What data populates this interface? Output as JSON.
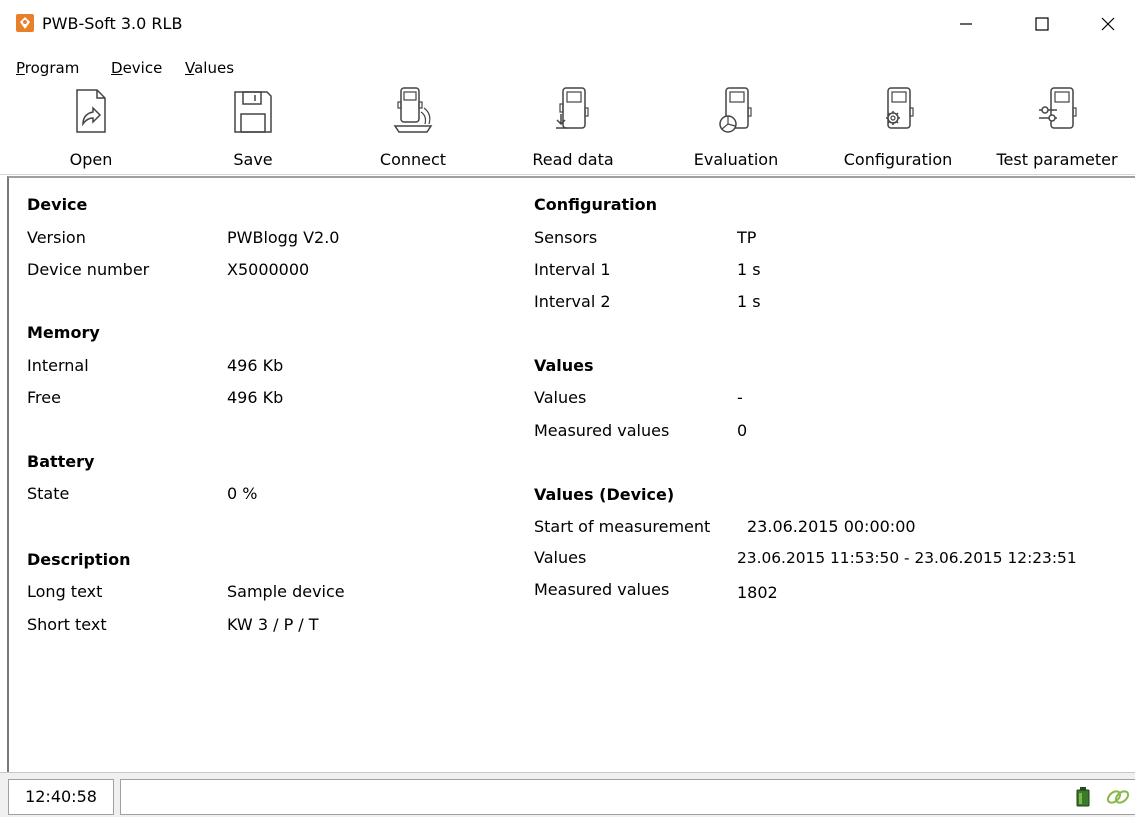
{
  "window": {
    "title": "PWB-Soft 3.0 RLB",
    "icon": "app-logo-icon",
    "controls": [
      "minimize-icon",
      "maximize-icon",
      "close-icon"
    ]
  },
  "menu": {
    "items": [
      {
        "label": "Program",
        "accel": "P"
      },
      {
        "label": "Device",
        "accel": "D"
      },
      {
        "label": "Values",
        "accel": "V"
      }
    ]
  },
  "toolbar": {
    "buttons": [
      {
        "label": "Open",
        "icon": "open-file-icon"
      },
      {
        "label": "Save",
        "icon": "floppy-disk-icon"
      },
      {
        "label": "Connect",
        "icon": "device-connect-icon"
      },
      {
        "label": "Read data",
        "icon": "device-download-icon"
      },
      {
        "label": "Evaluation",
        "icon": "device-chart-icon"
      },
      {
        "label": "Configuration",
        "icon": "device-gear-icon"
      },
      {
        "label": "Test parameter",
        "icon": "device-sliders-icon"
      }
    ]
  },
  "left": {
    "device": {
      "title": "Device",
      "rows": [
        {
          "label": "Version",
          "value": "PWBlogg V2.0"
        },
        {
          "label": "Device number",
          "value": "X5000000"
        }
      ]
    },
    "memory": {
      "title": "Memory",
      "rows": [
        {
          "label": "Internal",
          "value": "496 Kb"
        },
        {
          "label": "Free",
          "value": "496 Kb"
        }
      ]
    },
    "battery": {
      "title": "Battery",
      "rows": [
        {
          "label": "State",
          "value": "0 %"
        }
      ]
    },
    "description": {
      "title": "Description",
      "rows": [
        {
          "label": "Long text",
          "value": "Sample device"
        },
        {
          "label": "Short text",
          "value": "KW 3 / P / T"
        }
      ]
    }
  },
  "right": {
    "configuration": {
      "title": "Configuration",
      "rows": [
        {
          "label": "Sensors",
          "value": "TP"
        },
        {
          "label": "Interval 1",
          "value": "1 s"
        },
        {
          "label": "Interval 2",
          "value": "1 s"
        }
      ]
    },
    "values": {
      "title": "Values",
      "rows": [
        {
          "label": "Values",
          "value": "-"
        },
        {
          "label": "Measured values",
          "value": "0"
        }
      ]
    },
    "values_device": {
      "title": "Values (Device)",
      "rows": [
        {
          "label": "Start of measurement",
          "value": "23.06.2015 00:00:00"
        },
        {
          "label": "Values",
          "value": "23.06.2015 11:53:50 - 23.06.2015 12:23:51"
        },
        {
          "label": "Measured values",
          "value": "1802"
        }
      ]
    }
  },
  "status": {
    "time": "12:40:58",
    "icons": [
      "battery-icon",
      "link-icon"
    ],
    "battery_color": "#3a7a2a",
    "link_color": "#8ab84a"
  },
  "colors": {
    "app_icon": "#e8802a"
  }
}
